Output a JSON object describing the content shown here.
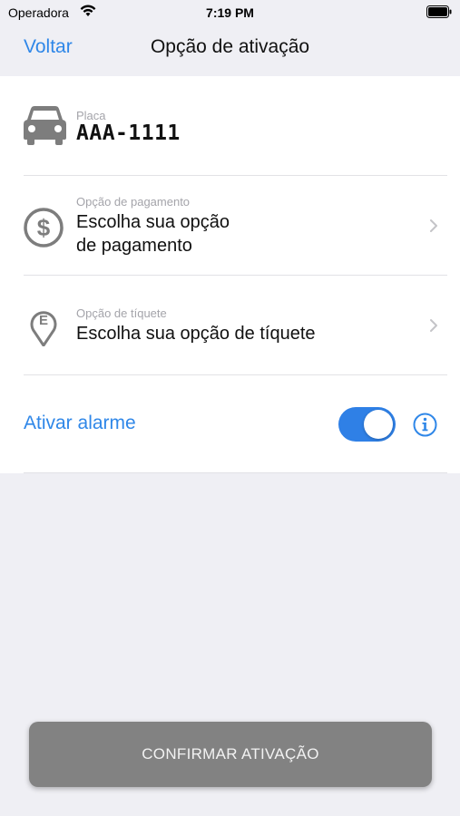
{
  "status_bar": {
    "carrier": "Operadora",
    "time": "7:19 PM",
    "wifi_icon": "wifi-icon",
    "battery_icon": "battery-full-icon"
  },
  "nav": {
    "back_label": "Voltar",
    "title": "Opção de ativação"
  },
  "plate": {
    "label": "Placa",
    "value": "AAA-1111",
    "icon": "car-icon"
  },
  "payment": {
    "label": "Opção de pagamento",
    "value_line1": "Escolha sua opção",
    "value_line2": "de pagamento",
    "icon": "dollar-icon"
  },
  "ticket": {
    "label": "Opção de tíquete",
    "value": "Escolha sua opção de tíquete",
    "icon": "parking-ticket-icon"
  },
  "alarm": {
    "label": "Ativar alarme",
    "enabled": true,
    "info_icon": "info-icon"
  },
  "confirm_button": {
    "label": "CONFIRMAR ATIVAÇÃO"
  },
  "colors": {
    "accent": "#2f87e8",
    "background": "#efeff4",
    "button_disabled": "#828282"
  }
}
